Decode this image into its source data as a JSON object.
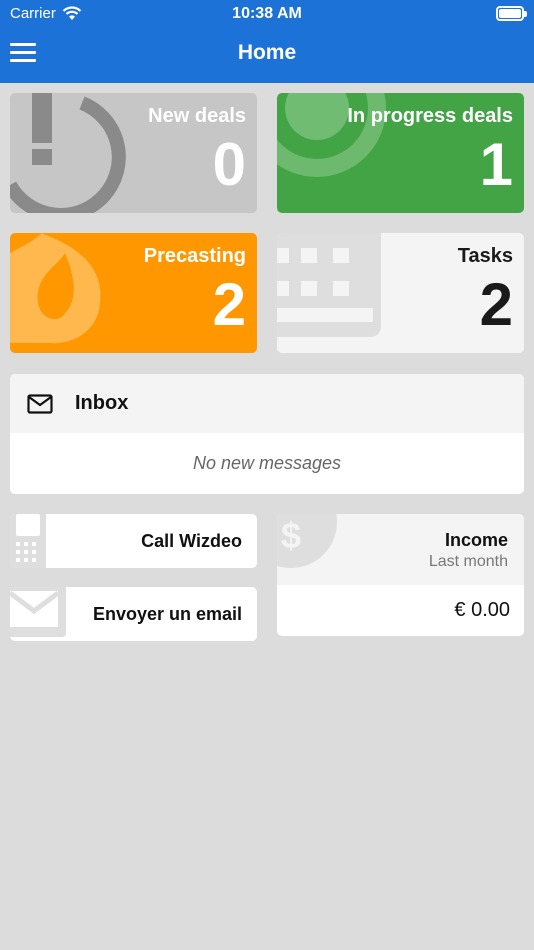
{
  "status": {
    "carrier": "Carrier",
    "time": "10:38 AM"
  },
  "header": {
    "title": "Home",
    "menu_icon": "hamburger-menu-icon"
  },
  "tiles": {
    "new_deals": {
      "label": "New deals",
      "count": "0",
      "color": "#c6c6c6",
      "icon": "exclamation-icon"
    },
    "in_progress": {
      "label": "In progress deals",
      "count": "1",
      "color": "#43a446",
      "icon": "target-icon"
    },
    "precasting": {
      "label": "Precasting",
      "count": "2",
      "color": "#ff9800",
      "icon": "flame-icon"
    },
    "tasks": {
      "label": "Tasks",
      "count": "2",
      "color": "#f4f4f4",
      "icon": "grid-icon"
    }
  },
  "inbox": {
    "title": "Inbox",
    "empty": "No new messages",
    "icon": "envelope-icon"
  },
  "actions": {
    "call": {
      "label": "Call Wizdeo",
      "icon": "phone-icon"
    },
    "email": {
      "label": "Envoyer un email",
      "icon": "envelope-icon"
    }
  },
  "income": {
    "title": "Income",
    "subtitle": "Last month",
    "value": "€ 0.00",
    "icon": "dollar-icon"
  },
  "colors": {
    "accent": "#1c72d6",
    "background": "#dcdcdc"
  }
}
